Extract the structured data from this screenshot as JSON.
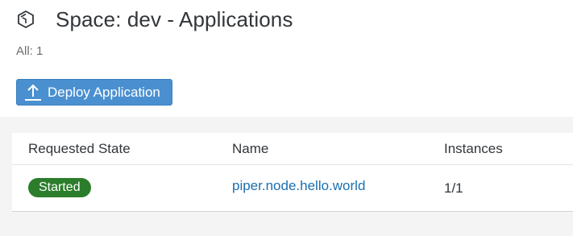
{
  "header": {
    "icon": "space-hexagon-icon",
    "title": "Space: dev - Applications"
  },
  "summary": {
    "count_label": "All: 1"
  },
  "toolbar": {
    "deploy_icon": "upload-icon",
    "deploy_label": "Deploy Application",
    "accent_color": "#4a90d0"
  },
  "table": {
    "columns": [
      "Requested State",
      "Name",
      "Instances"
    ],
    "rows": [
      {
        "requested_state": "Started",
        "name": "piper.node.hello.world",
        "instances": "1/1"
      }
    ]
  },
  "colors": {
    "status_started": "#2b7d2b",
    "link": "#1a6fb0"
  }
}
